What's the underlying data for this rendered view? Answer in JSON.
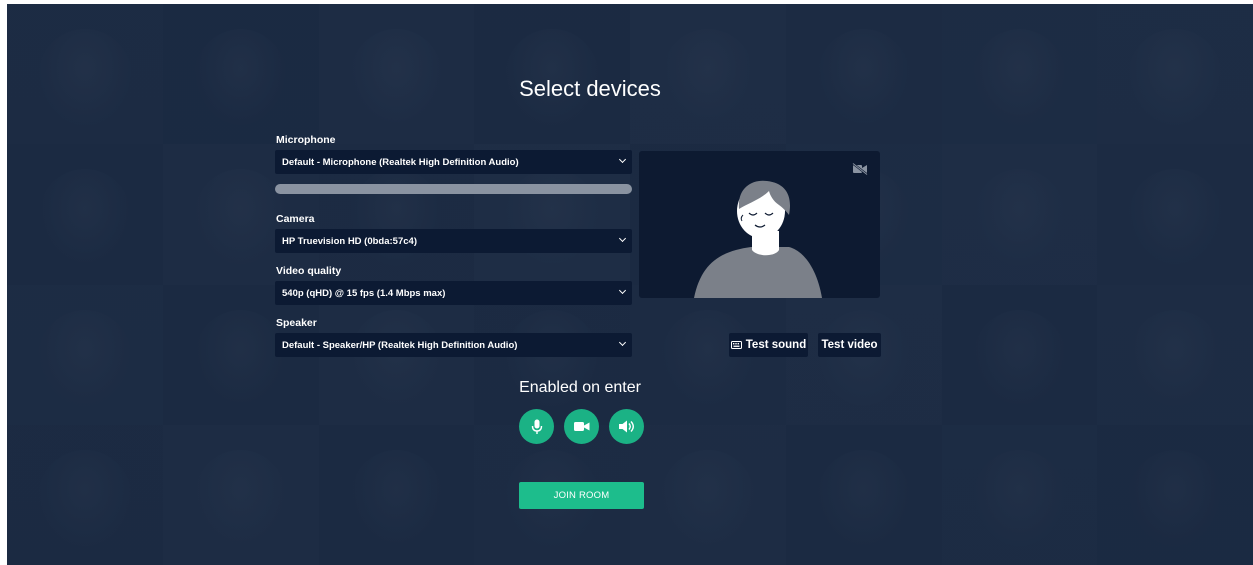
{
  "title": "Select devices",
  "microphone": {
    "label": "Microphone",
    "value": "Default - Microphone (Realtek High Definition Audio)",
    "level": 0
  },
  "camera": {
    "label": "Camera",
    "value": "HP Truevision HD (0bda:57c4)"
  },
  "video_quality": {
    "label": "Video quality",
    "value": "540p (qHD) @ 15 fps (1.4 Mbps max)"
  },
  "speaker": {
    "label": "Speaker",
    "value": "Default - Speaker/HP (Realtek High Definition Audio)"
  },
  "preview": {
    "camera_status_icon": "video-off-icon"
  },
  "buttons": {
    "test_sound": "Test sound",
    "test_sound_icon": "keyboard-icon",
    "test_video": "Test video",
    "join_room": "JOIN ROOM"
  },
  "enabled_on_enter": {
    "heading": "Enabled on enter",
    "toggles": [
      {
        "icon": "microphone-icon",
        "enabled": true
      },
      {
        "icon": "video-camera-icon",
        "enabled": true
      },
      {
        "icon": "speaker-icon",
        "enabled": true
      }
    ]
  },
  "colors": {
    "accent": "#1dbd8c",
    "toggle_bg": "#1bb285",
    "select_bg": "#0c1a33",
    "overlay": "#18273f"
  }
}
